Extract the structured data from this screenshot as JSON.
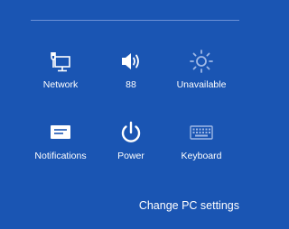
{
  "colors": {
    "background": "#1a55b3",
    "foreground": "#ffffff",
    "divider": "#6d92d6"
  },
  "tiles": [
    {
      "id": "network",
      "icon": "network-icon",
      "label": "Network"
    },
    {
      "id": "volume",
      "icon": "speaker-icon",
      "label": "88"
    },
    {
      "id": "brightness",
      "icon": "brightness-icon",
      "label": "Unavailable"
    },
    {
      "id": "notifications",
      "icon": "notifications-icon",
      "label": "Notifications"
    },
    {
      "id": "power",
      "icon": "power-icon",
      "label": "Power"
    },
    {
      "id": "keyboard",
      "icon": "keyboard-icon",
      "label": "Keyboard"
    }
  ],
  "change_pc_settings_label": "Change PC settings"
}
